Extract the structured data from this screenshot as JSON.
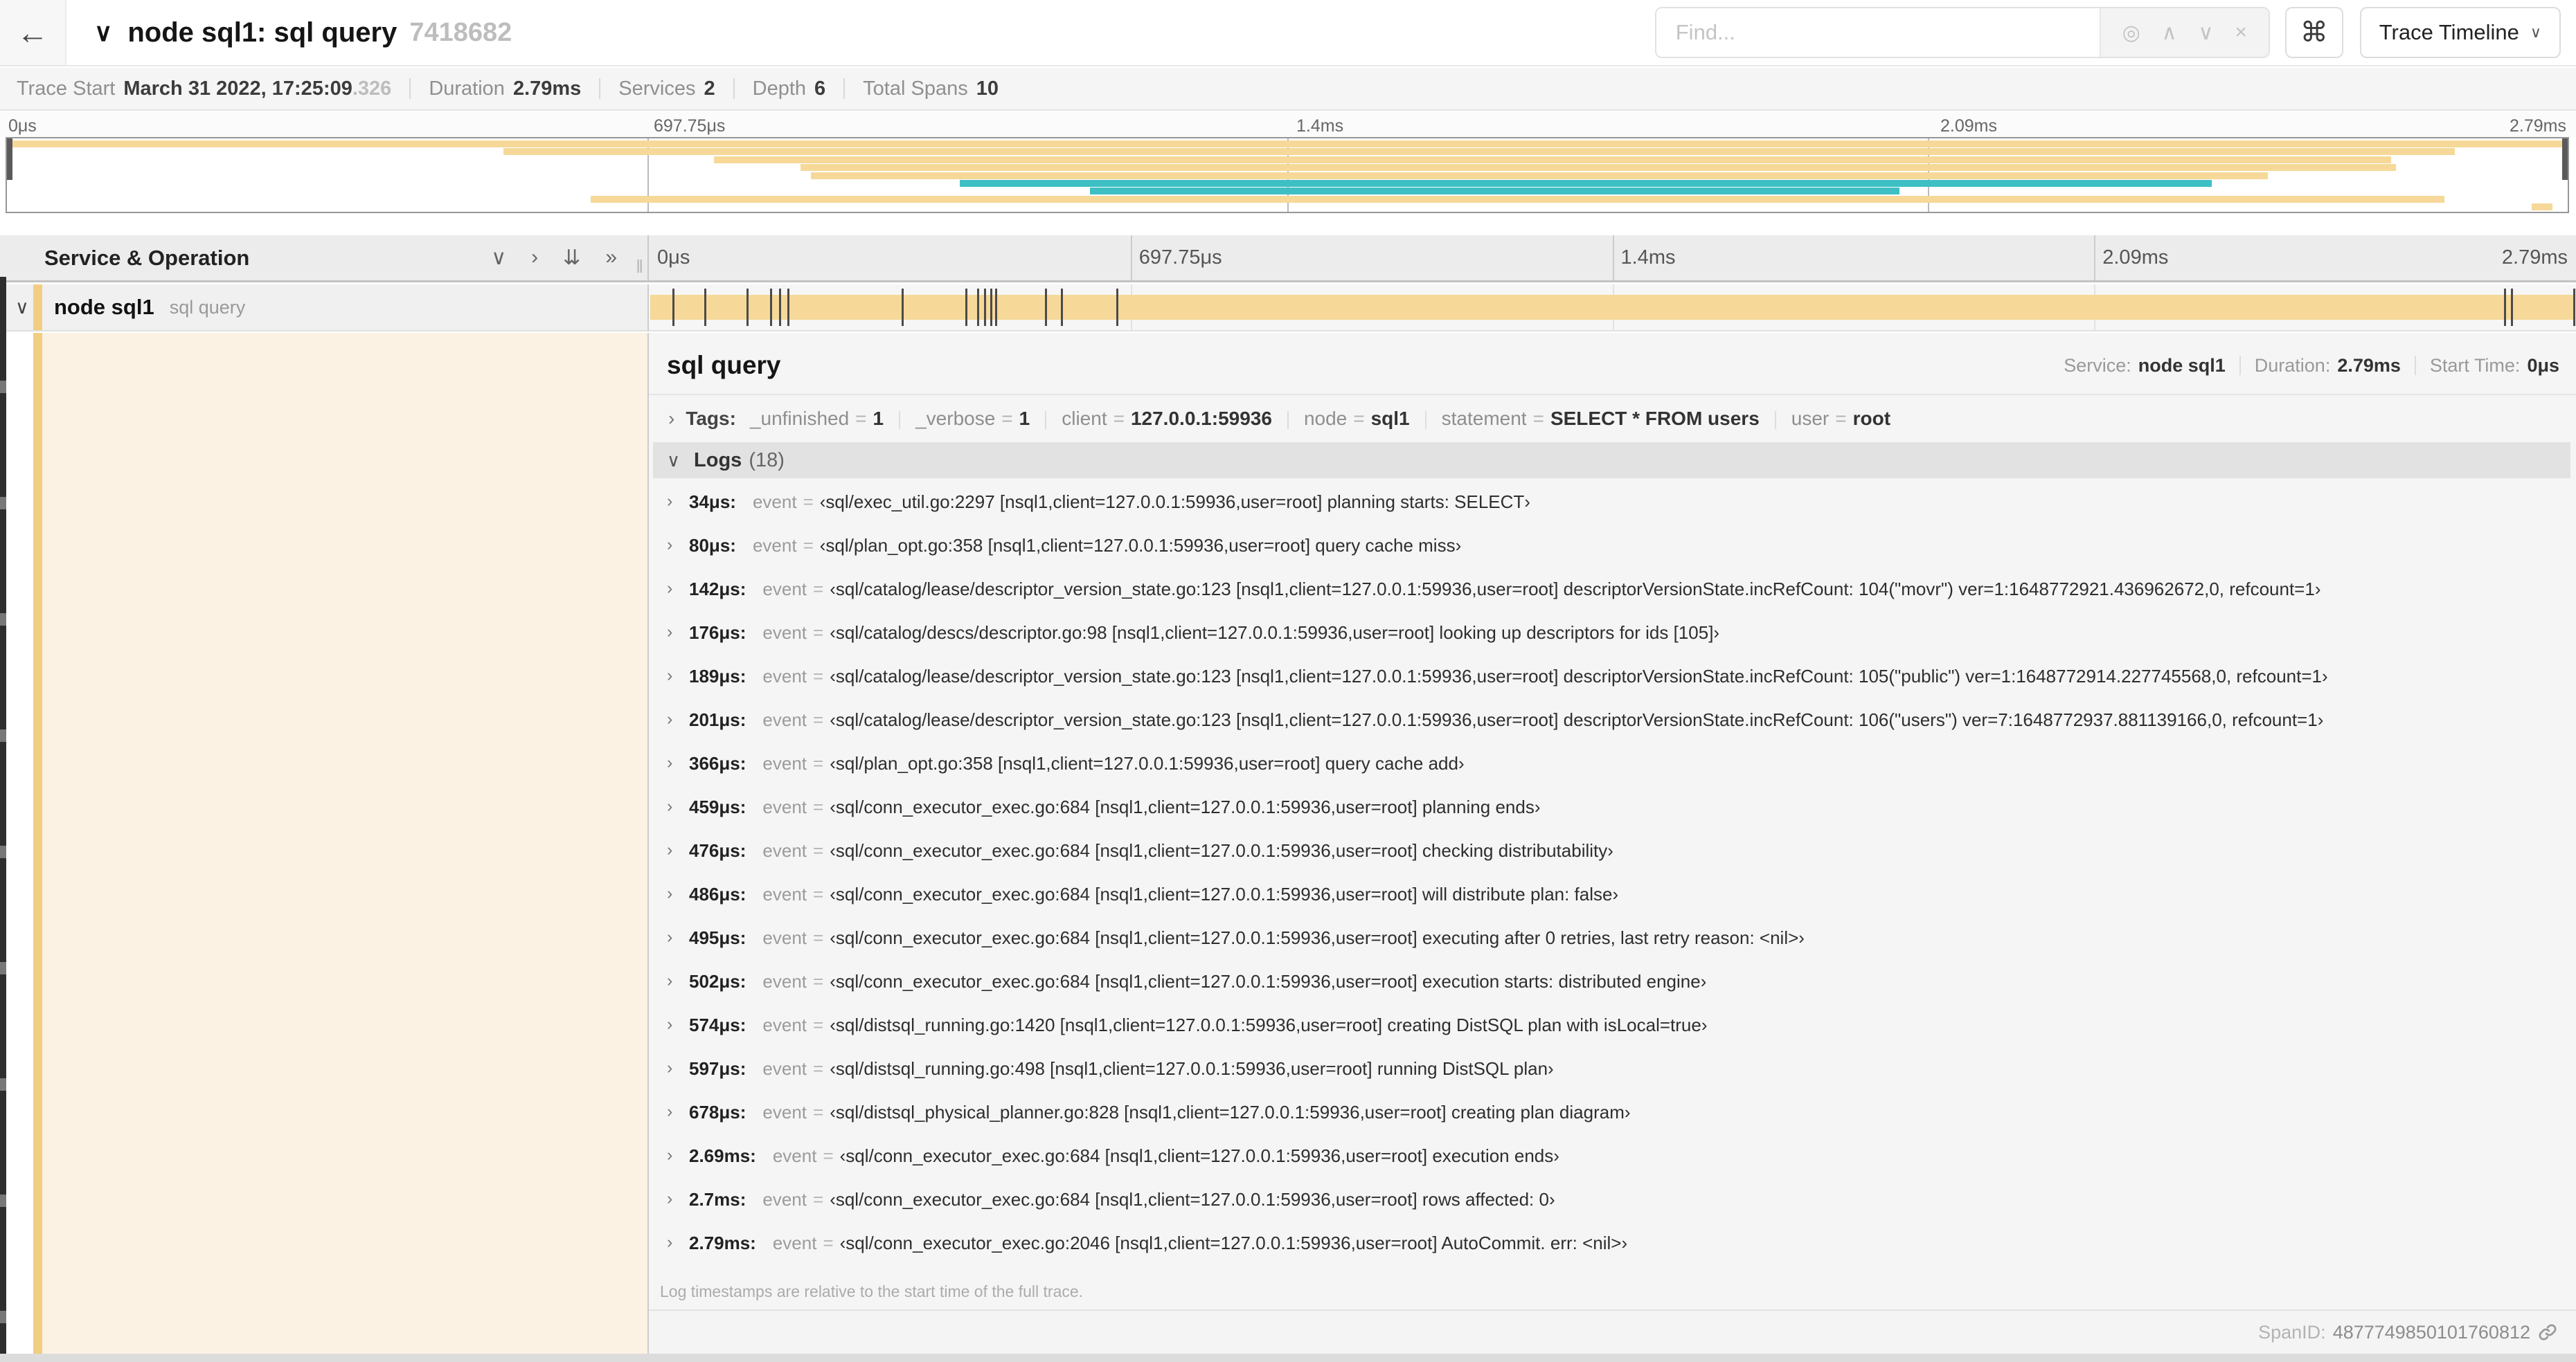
{
  "header": {
    "back_icon": "←",
    "collapse_icon": "∨",
    "title": "node sql1: sql query",
    "trace_id_short": "7418682",
    "find_placeholder": "Find...",
    "find_icons": [
      "◎",
      "∧",
      "∨",
      "×"
    ],
    "shortcut_icon": "⌘",
    "view_dropdown": "Trace Timeline",
    "view_dropdown_chevron": "∨"
  },
  "summary": {
    "items": [
      {
        "label": "Trace Start",
        "value": "March 31 2022, 17:25:09",
        "suffix": ".326"
      },
      {
        "label": "Duration",
        "value": "2.79ms"
      },
      {
        "label": "Services",
        "value": "2"
      },
      {
        "label": "Depth",
        "value": "6"
      },
      {
        "label": "Total Spans",
        "value": "10"
      }
    ]
  },
  "minimap": {
    "axis_ticks": [
      "0μs",
      "697.75μs",
      "1.4ms",
      "2.09ms",
      "2.79ms"
    ],
    "spans": [
      {
        "start": 0,
        "end": 100,
        "color": "tan"
      },
      {
        "start": 19.4,
        "end": 95.6,
        "color": "tan"
      },
      {
        "start": 27.6,
        "end": 93.1,
        "color": "tan"
      },
      {
        "start": 31.0,
        "end": 93.3,
        "color": "tan"
      },
      {
        "start": 31.4,
        "end": 88.3,
        "color": "tan"
      },
      {
        "start": 37.2,
        "end": 86.1,
        "color": "teal"
      },
      {
        "start": 42.3,
        "end": 73.9,
        "color": "teal"
      },
      {
        "start": 22.8,
        "end": 95.2,
        "color": "tan"
      },
      {
        "start": 98.6,
        "end": 99.4,
        "color": "tan"
      }
    ]
  },
  "timeline": {
    "column_header": "Service & Operation",
    "controls": [
      {
        "glyph": "∨"
      },
      {
        "glyph": "›"
      },
      {
        "glyph": "⇊"
      },
      {
        "glyph": "»"
      }
    ],
    "resizer_glyph": "‖",
    "ruler_ticks": [
      "0μs",
      "697.75μs",
      "1.4ms",
      "2.09ms",
      "2.79ms"
    ],
    "row": {
      "expander": "∨",
      "service": "node sql1",
      "operation": "sql query"
    },
    "duration_us": 2790
  },
  "detail": {
    "operation": "sql query",
    "service_label": "Service:",
    "service": "node sql1",
    "duration_label": "Duration:",
    "duration": "2.79ms",
    "start_label": "Start Time:",
    "start": "0μs",
    "tags_expander": "›",
    "tags_label": "Tags:",
    "tags": [
      {
        "key": "_unfinished",
        "value": "1"
      },
      {
        "key": "_verbose",
        "value": "1"
      },
      {
        "key": "client",
        "value": "127.0.0.1:59936"
      },
      {
        "key": "node",
        "value": "sql1"
      },
      {
        "key": "statement",
        "value": "SELECT * FROM users"
      },
      {
        "key": "user",
        "value": "root"
      }
    ],
    "logs_expander": "∨",
    "logs_label": "Logs",
    "logs_count": "(18)",
    "log_row_expander": "›",
    "log_key": "event",
    "eq_sign": "=",
    "logs": [
      {
        "t": "34μs",
        "us": 34,
        "event": "‹sql/exec_util.go:2297 [nsql1,client=127.0.0.1:59936,user=root] planning starts: SELECT›"
      },
      {
        "t": "80μs",
        "us": 80,
        "event": "‹sql/plan_opt.go:358 [nsql1,client=127.0.0.1:59936,user=root] query cache miss›"
      },
      {
        "t": "142μs",
        "us": 142,
        "event": "‹sql/catalog/lease/descriptor_version_state.go:123 [nsql1,client=127.0.0.1:59936,user=root] descriptorVersionState.incRefCount: 104(\"movr\") ver=1:1648772921.436962672,0, refcount=1›"
      },
      {
        "t": "176μs",
        "us": 176,
        "event": "‹sql/catalog/descs/descriptor.go:98 [nsql1,client=127.0.0.1:59936,user=root] looking up descriptors for ids [105]›"
      },
      {
        "t": "189μs",
        "us": 189,
        "event": "‹sql/catalog/lease/descriptor_version_state.go:123 [nsql1,client=127.0.0.1:59936,user=root] descriptorVersionState.incRefCount: 105(\"public\") ver=1:1648772914.227745568,0, refcount=1›"
      },
      {
        "t": "201μs",
        "us": 201,
        "event": "‹sql/catalog/lease/descriptor_version_state.go:123 [nsql1,client=127.0.0.1:59936,user=root] descriptorVersionState.incRefCount: 106(\"users\") ver=7:1648772937.881139166,0, refcount=1›"
      },
      {
        "t": "366μs",
        "us": 366,
        "event": "‹sql/plan_opt.go:358 [nsql1,client=127.0.0.1:59936,user=root] query cache add›"
      },
      {
        "t": "459μs",
        "us": 459,
        "event": "‹sql/conn_executor_exec.go:684 [nsql1,client=127.0.0.1:59936,user=root] planning ends›"
      },
      {
        "t": "476μs",
        "us": 476,
        "event": "‹sql/conn_executor_exec.go:684 [nsql1,client=127.0.0.1:59936,user=root] checking distributability›"
      },
      {
        "t": "486μs",
        "us": 486,
        "event": "‹sql/conn_executor_exec.go:684 [nsql1,client=127.0.0.1:59936,user=root] will distribute plan: false›"
      },
      {
        "t": "495μs",
        "us": 495,
        "event": "‹sql/conn_executor_exec.go:684 [nsql1,client=127.0.0.1:59936,user=root] executing after 0 retries, last retry reason: <nil>›"
      },
      {
        "t": "502μs",
        "us": 502,
        "event": "‹sql/conn_executor_exec.go:684 [nsql1,client=127.0.0.1:59936,user=root] execution starts: distributed engine›"
      },
      {
        "t": "574μs",
        "us": 574,
        "event": "‹sql/distsql_running.go:1420 [nsql1,client=127.0.0.1:59936,user=root] creating DistSQL plan with isLocal=true›"
      },
      {
        "t": "597μs",
        "us": 597,
        "event": "‹sql/distsql_running.go:498 [nsql1,client=127.0.0.1:59936,user=root] running DistSQL plan›"
      },
      {
        "t": "678μs",
        "us": 678,
        "event": "‹sql/distsql_physical_planner.go:828 [nsql1,client=127.0.0.1:59936,user=root] creating plan diagram›"
      },
      {
        "t": "2.69ms",
        "us": 2690,
        "event": "‹sql/conn_executor_exec.go:684 [nsql1,client=127.0.0.1:59936,user=root] execution ends›"
      },
      {
        "t": "2.7ms",
        "us": 2700,
        "event": "‹sql/conn_executor_exec.go:684 [nsql1,client=127.0.0.1:59936,user=root] rows affected: 0›"
      },
      {
        "t": "2.79ms",
        "us": 2790,
        "event": "‹sql/conn_executor_exec.go:2046 [nsql1,client=127.0.0.1:59936,user=root] AutoCommit. err: <nil>›"
      }
    ],
    "footnote": "Log timestamps are relative to the start time of the full trace.",
    "span_id_label": "SpanID:",
    "span_id": "4877749850101760812"
  },
  "colors": {
    "tan": "#F6D898",
    "teal": "#3DBFC4",
    "band": "#F2CE82",
    "cream": "#FBF2E4"
  }
}
